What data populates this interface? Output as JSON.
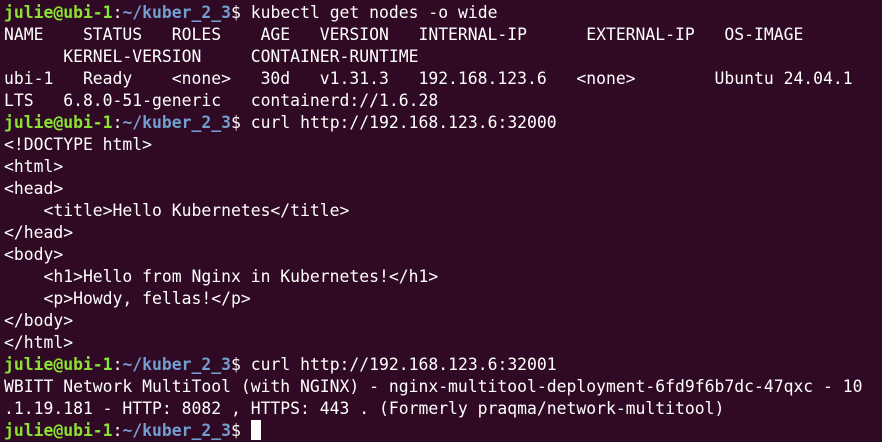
{
  "prompt": {
    "user_host": "julie@ubi-1",
    "sep": ":",
    "path": "~/kuber_2_3",
    "symbol": "$ "
  },
  "commands": [
    "kubectl get nodes -o wide",
    "curl http://192.168.123.6:32000",
    "curl http://192.168.123.6:32001"
  ],
  "output_blocks": [
    [
      "NAME    STATUS   ROLES    AGE   VERSION   INTERNAL-IP      EXTERNAL-IP   OS-IMAGE",
      "      KERNEL-VERSION     CONTAINER-RUNTIME",
      "ubi-1   Ready    <none>   30d   v1.31.3   192.168.123.6   <none>        Ubuntu 24.04.1",
      "LTS   6.8.0-51-generic   containerd://1.6.28"
    ],
    [
      "<!DOCTYPE html>",
      "<html>",
      "<head>",
      "    <title>Hello Kubernetes</title>",
      "</head>",
      "<body>",
      "    <h1>Hello from Nginx in Kubernetes!</h1>",
      "    <p>Howdy, fellas!</p>",
      "</body>",
      "</html>"
    ],
    [
      "WBITT Network MultiTool (with NGINX) - nginx-multitool-deployment-6fd9f6b7dc-47qxc - 10",
      ".1.19.181 - HTTP: 8082 , HTTPS: 443 . (Formerly praqma/network-multitool)"
    ]
  ],
  "colors": {
    "background": "#300a24",
    "user_host": "#8ae234",
    "path": "#729fcf",
    "text": "#ffffff"
  }
}
